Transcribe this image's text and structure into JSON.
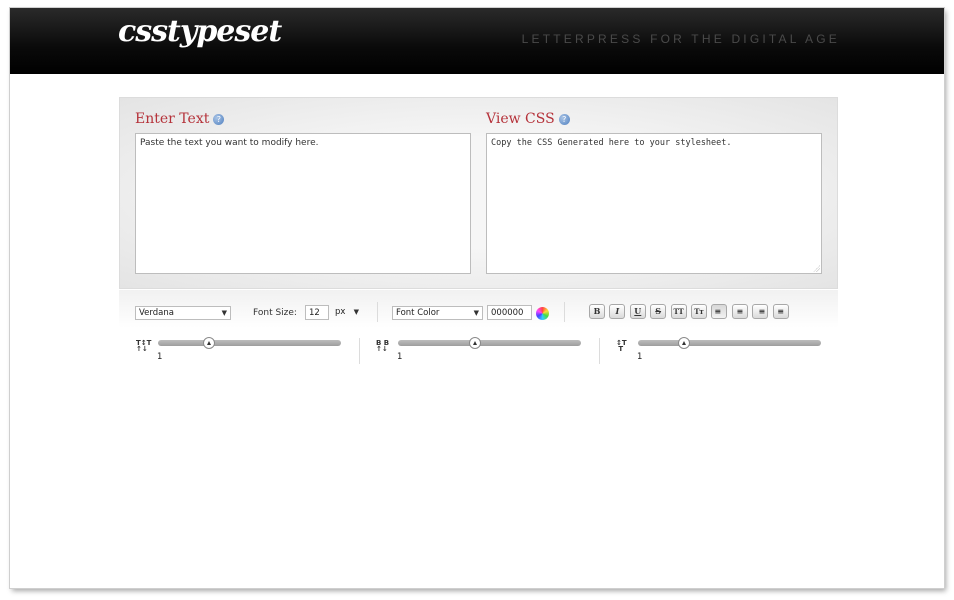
{
  "header": {
    "logo": "csstypeset",
    "tagline": "LETTERPRESS FOR THE DIGITAL AGE"
  },
  "input_section": {
    "label": "Enter Text",
    "placeholder": "Paste the text you want to modify here."
  },
  "output_section": {
    "label": "View CSS",
    "placeholder": "Copy the CSS Generated here to your stylesheet."
  },
  "toolbar": {
    "font_family": "Verdana",
    "font_size_label": "Font Size:",
    "font_size_value": "12",
    "font_size_unit": "px",
    "font_color_select": "Font Color",
    "font_color_value": "000000",
    "format_buttons": [
      {
        "name": "bold",
        "glyph": "B"
      },
      {
        "name": "italic",
        "glyph": "I"
      },
      {
        "name": "underline",
        "glyph": "U"
      },
      {
        "name": "strikethrough",
        "glyph": "S"
      },
      {
        "name": "uppercase",
        "glyph": "TT"
      },
      {
        "name": "capitalize",
        "glyph": "Tт"
      },
      {
        "name": "align-left",
        "glyph": "≡"
      },
      {
        "name": "align-center",
        "glyph": "≡"
      },
      {
        "name": "align-right",
        "glyph": "≡"
      },
      {
        "name": "justify",
        "glyph": "≡"
      }
    ]
  },
  "sliders": [
    {
      "name": "letter-spacing",
      "icon": "letter-spacing-icon",
      "value": "1",
      "level_pct": 28
    },
    {
      "name": "word-spacing",
      "icon": "word-spacing-icon",
      "value": "1",
      "level_pct": 42
    },
    {
      "name": "line-height",
      "icon": "line-height-icon",
      "value": "1",
      "level_pct": 25
    }
  ]
}
